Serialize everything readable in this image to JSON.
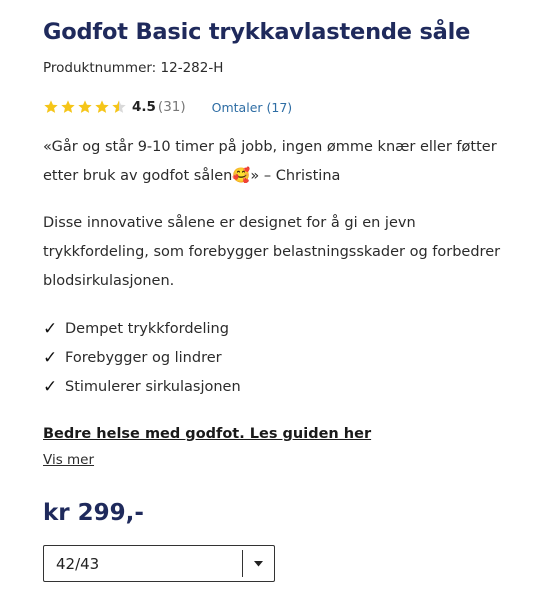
{
  "product": {
    "title": "Godfot Basic trykkavlastende såle",
    "sku": "Produktnummer: 12-282-H"
  },
  "rating": {
    "value": "4.5",
    "count": "(31)",
    "stars": 4.5,
    "reviews_link": "Omtaler (17)",
    "star_color": "#f5c518"
  },
  "quote": {
    "text": "«Går og står 9-10 timer på jobb, ingen ømme knær eller føtter etter bruk av godfot sålen🥰» – Christina"
  },
  "description": {
    "text": "Disse innovative sålene er designet for å gi en jevn trykkfordeling, som forebygger belastningsskader og forbedrer blodsirkulasjonen."
  },
  "features": [
    {
      "icon": "checkmark-icon",
      "label": "Dempet trykkfordeling"
    },
    {
      "icon": "checkmark-icon",
      "label": "Forebygger og lindrer"
    },
    {
      "icon": "checkmark-icon",
      "label": "Stimulerer sirkulasjonen"
    }
  ],
  "links": {
    "guide": "Bedre helse med godfot. Les guiden her",
    "more": "Vis mer"
  },
  "price": {
    "label": "kr 299,-"
  },
  "size_select": {
    "selected": "42/43"
  },
  "colors": {
    "title": "#1f2a5c",
    "link": "#2e6da4"
  }
}
